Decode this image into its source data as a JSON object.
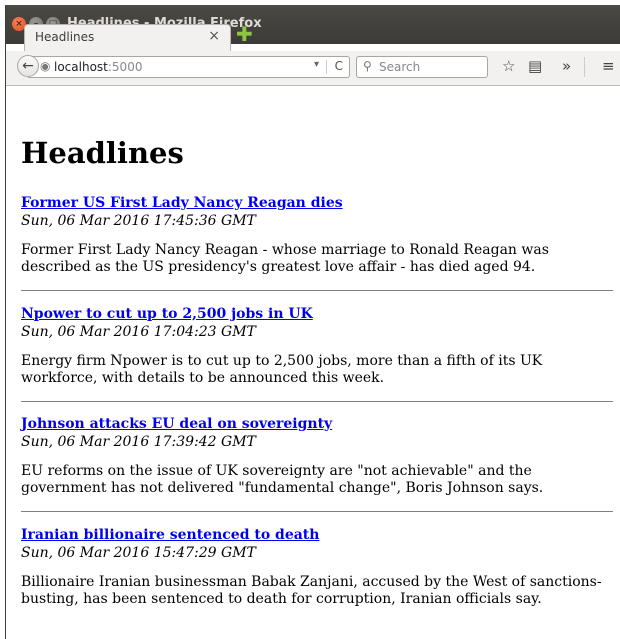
{
  "window": {
    "title": "Headlines - Mozilla Firefox"
  },
  "tab": {
    "label": "Headlines",
    "close": "×"
  },
  "toolbar": {
    "back_glyph": "←",
    "url_host": "localhost",
    "url_port": ":5000",
    "dropdown_glyph": "▾",
    "reload_glyph": "C",
    "search_placeholder": "Search",
    "bookmark_glyph": "☆",
    "reader_glyph": "▤",
    "overflow_glyph": "»",
    "menu_glyph": "≡"
  },
  "page": {
    "heading": "Headlines",
    "articles": [
      {
        "title": "Former US First Lady Nancy Reagan dies",
        "date": "Sun, 06 Mar 2016 17:45:36 GMT",
        "summary": "Former First Lady Nancy Reagan - whose marriage to Ronald Reagan was described as the US presidency's greatest love affair - has died aged 94."
      },
      {
        "title": "Npower to cut up to 2,500 jobs in UK",
        "date": "Sun, 06 Mar 2016 17:04:23 GMT",
        "summary": "Energy firm Npower is to cut up to 2,500 jobs, more than a fifth of its UK workforce, with details to be announced this week."
      },
      {
        "title": "Johnson attacks EU deal on sovereignty",
        "date": "Sun, 06 Mar 2016 17:39:42 GMT",
        "summary": "EU reforms on the issue of UK sovereignty are \"not achievable\" and the government has not delivered \"fundamental change\", Boris Johnson says."
      },
      {
        "title": "Iranian billionaire sentenced to death",
        "date": "Sun, 06 Mar 2016 15:47:29 GMT",
        "summary": "Billionaire Iranian businessman Babak Zanjani, accused by the West of sanctions-busting, has been sentenced to death for corruption, Iranian officials say."
      }
    ]
  }
}
